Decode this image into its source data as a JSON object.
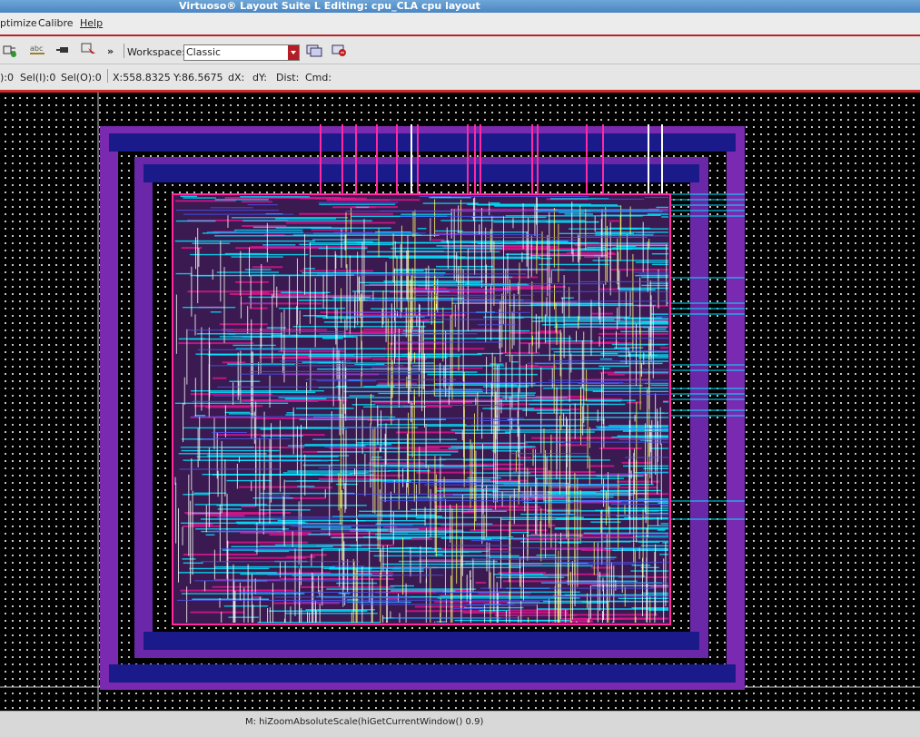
{
  "window": {
    "title": "Virtuoso® Layout Suite L Editing: cpu_CLA cpu layout"
  },
  "menu": {
    "items": [
      {
        "label": "ptimize"
      },
      {
        "label": "Calibre"
      },
      {
        "label": "Help"
      }
    ]
  },
  "toolbar": {
    "icons": [
      "create-instance-icon",
      "create-label-icon",
      "create-pin-icon",
      "select-icon"
    ],
    "overflow": "»",
    "workspace_label": "Workspace:",
    "workspace_value": "Classic"
  },
  "status": {
    "sel_partial": "):0",
    "sel_i": "Sel(I):0",
    "sel_o": "Sel(O):0",
    "x": "X:558.8325",
    "y": "Y:86.5675",
    "dx": "dX:",
    "dy": "dY:",
    "dist": "Dist:",
    "cmd": "Cmd:"
  },
  "bottom": {
    "prompt": "M: hiZoomAbsoluteScale(hiGetCurrentWindow() 0.9)"
  },
  "colors": {
    "accent": "#b8262a",
    "title_bg": "#4a86c2",
    "canvas_bg": "#000000",
    "metal_cyan": "#00e5ff",
    "metal_magenta": "#ff1aa8",
    "metal_yellow": "#ffff66",
    "ring_blue": "#1a1a8a",
    "ring_purple": "#8a2fc0"
  }
}
